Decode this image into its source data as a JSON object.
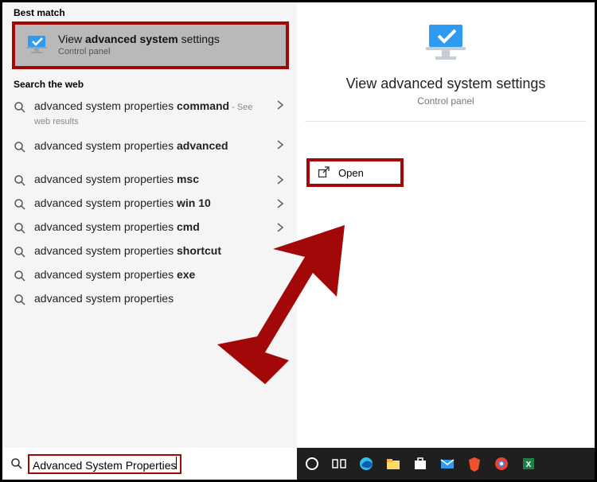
{
  "sections": {
    "best_match": "Best match",
    "search_web": "Search the web"
  },
  "best_match": {
    "title_pre": "View ",
    "title_bold": "advanced system",
    "title_post": " settings",
    "subtitle": "Control panel"
  },
  "web_results": [
    {
      "pre": "advanced system properties ",
      "bold": "command",
      "post": "",
      "sub": " - See web results",
      "chevron": true,
      "tall": true
    },
    {
      "pre": "advanced system properties ",
      "bold": "advanced",
      "post": "",
      "sub": "",
      "chevron": true,
      "tall": true
    },
    {
      "pre": "advanced system properties ",
      "bold": "msc",
      "post": "",
      "sub": "",
      "chevron": true,
      "tall": false
    },
    {
      "pre": "advanced system properties ",
      "bold": "win 10",
      "post": "",
      "sub": "",
      "chevron": true,
      "tall": false
    },
    {
      "pre": "advanced system properties ",
      "bold": "cmd",
      "post": "",
      "sub": "",
      "chevron": true,
      "tall": false
    },
    {
      "pre": "advanced system properties ",
      "bold": "shortcut",
      "post": "",
      "sub": "",
      "chevron": false,
      "tall": false
    },
    {
      "pre": "advanced system properties ",
      "bold": "exe",
      "post": "",
      "sub": "",
      "chevron": false,
      "tall": false
    },
    {
      "pre": "advanced system properties",
      "bold": "",
      "post": "",
      "sub": "",
      "chevron": false,
      "tall": false
    }
  ],
  "preview": {
    "title": "View advanced system settings",
    "subtitle": "Control panel",
    "open_label": "Open"
  },
  "search": {
    "query": "Advanced System Properties"
  },
  "taskbar_icons": [
    "cortana-icon",
    "taskview-icon",
    "edge-icon",
    "explorer-icon",
    "store-icon",
    "mail-icon",
    "brave-icon",
    "chrome-icon",
    "excel-icon"
  ],
  "colors": {
    "annotation": "#a30808",
    "accent": "#2e9bf0"
  }
}
